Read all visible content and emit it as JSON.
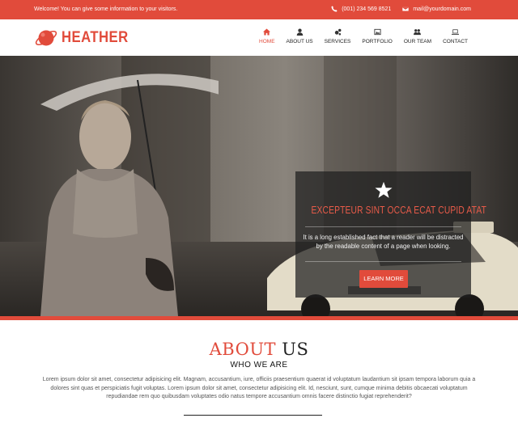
{
  "topbar": {
    "welcome": "Welcome! You can give some information to your visitors.",
    "phone": "(001) 234 569 8521",
    "email": "mail@yourdomain.com"
  },
  "brand": {
    "name": "HEATHER",
    "color": "#e14b3b"
  },
  "nav": {
    "items": [
      {
        "label": "HOME",
        "icon": "home-icon",
        "active": true
      },
      {
        "label": "ABOUT US",
        "icon": "user-icon"
      },
      {
        "label": "SERVICES",
        "icon": "gears-icon"
      },
      {
        "label": "PORTFOLIO",
        "icon": "picture-icon"
      },
      {
        "label": "OUR TEAM",
        "icon": "users-icon"
      },
      {
        "label": "CONTACT",
        "icon": "laptop-icon"
      }
    ]
  },
  "slider": {
    "title": "EXCEPTEUR SINT OCCA ECAT CUPID ATAT",
    "text": "It is a long established fact that a reader will be distracted by the readable content of a page when looking.",
    "button": "LEARN MORE",
    "icon": "star-icon",
    "slides": 3,
    "active_slide": 1
  },
  "about": {
    "title_accent": "ABOUT",
    "title_rest": "US",
    "subtitle": "WHO WE ARE",
    "body": "Lorem ipsum dolor sit amet, consectetur adipisicing elit. Magnam, accusantium, iure, officiis praesentium quaerat id voluptatum laudantium sit ipsam tempora laborum quia a dolores sint quas et perspiciatis fugit voluptas. Lorem ipsum dolor sit amet, consectetur adipisicing elit. Id, nesciunt, sunt, cumque minima debitis obcaecati voluptatum repudiandae rem quo quibusdam voluptates odio natus tempore accusantium omnis facere distinctio fugiat reprehenderit?"
  }
}
